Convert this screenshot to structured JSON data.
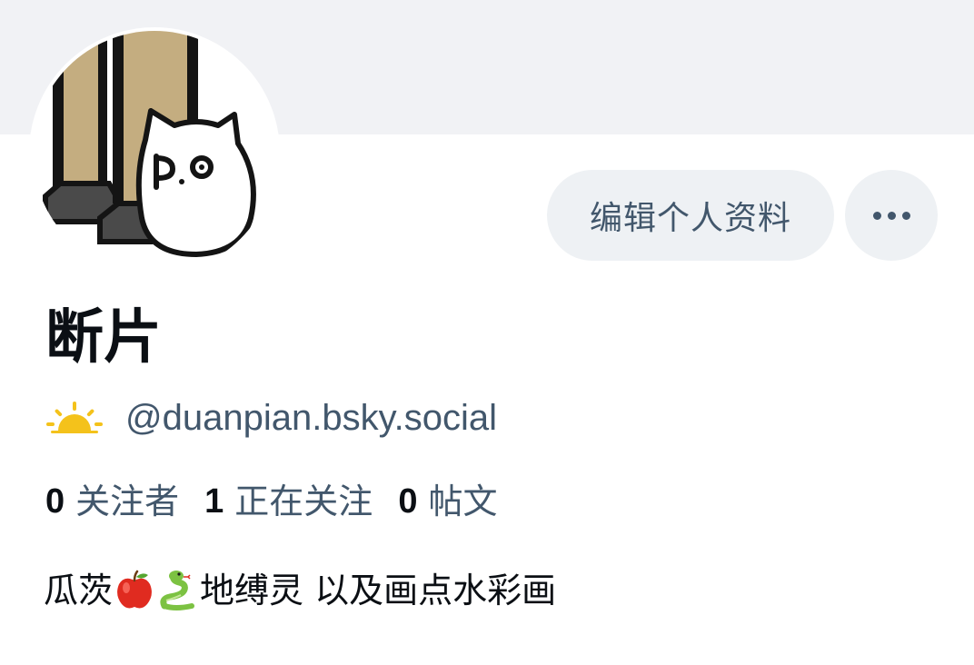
{
  "profile": {
    "display_name": "断片",
    "handle": "@duanpian.bsky.social",
    "handle_icon": "sunrise-icon",
    "avatar": "cat-peeking-avatar",
    "stats": [
      {
        "number": "0",
        "label": "关注者"
      },
      {
        "number": "1",
        "label": "正在关注"
      },
      {
        "number": "0",
        "label": "帖文"
      }
    ],
    "bio": {
      "part1": "瓜茨",
      "emoji1": "red-apple-icon",
      "emoji2": "snake-icon",
      "part2": "地缚灵 以及画点水彩画"
    }
  },
  "actions": {
    "edit_label": "编辑个人资料",
    "more_icon": "more-horizontal-icon"
  },
  "colors": {
    "banner": "#f1f2f5",
    "button_bg": "#eef1f4",
    "secondary_text": "#42576c",
    "primary_text": "#0b0f14"
  }
}
